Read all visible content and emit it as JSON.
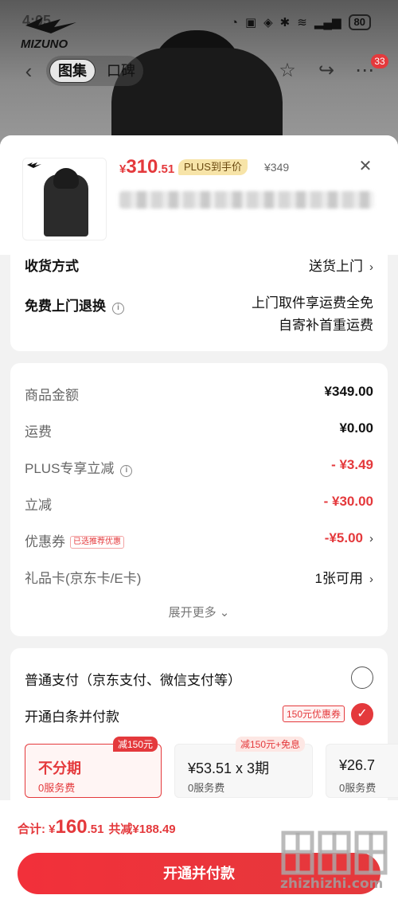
{
  "status_bar": {
    "time": "4:05",
    "battery": "80"
  },
  "brand": {
    "name": "MIZUNO"
  },
  "nav": {
    "tab_active": "图集",
    "tab_inactive": "口碑",
    "badge_count": "33"
  },
  "product": {
    "price_symbol": "¥",
    "price_int": "310",
    "price_dec": ".51",
    "plus_tag": "PLUS到手价",
    "original_price": "¥349"
  },
  "delivery": {
    "label": "收货方式",
    "value": "送货上门",
    "return_label": "免费上门退换",
    "return_line1": "上门取件享运费全免",
    "return_line2": "自寄补首重运费"
  },
  "costs": {
    "items": [
      {
        "label": "商品金额",
        "value": "¥349.00"
      },
      {
        "label": "运费",
        "value": "¥0.00"
      },
      {
        "label": "PLUS专享立减",
        "value": "- ¥3.49"
      },
      {
        "label": "立减",
        "value": "- ¥30.00"
      },
      {
        "label": "优惠券",
        "tag": "已选推荐优惠",
        "value": "-¥5.00"
      },
      {
        "label": "礼品卡(京东卡/E卡)",
        "value": "1张可用"
      }
    ],
    "expand_label": "展开更多"
  },
  "payment": {
    "normal_label": "普通支付（京东支付、微信支付等）",
    "baitiao_label": "开通白条并付款",
    "baitiao_coupon": "150元优惠券",
    "plans": [
      {
        "title": "不分期",
        "sub": "0服务费",
        "tag": "减150元"
      },
      {
        "title": "¥53.51 x 3期",
        "sub": "0服务费",
        "tag": "减150元+免息"
      },
      {
        "title": "¥26.7",
        "sub": "0服务费"
      }
    ]
  },
  "footer": {
    "total_label": "合计: ",
    "total_symbol": "¥",
    "total_int": "160",
    "total_dec": ".51",
    "saved": "共减¥188.49",
    "cta": "开通并付款"
  },
  "watermark": {
    "text": "zhizhizhi.com"
  },
  "colors": {
    "accent": "#e4393c",
    "plus_gold": "#f7e4a8"
  }
}
